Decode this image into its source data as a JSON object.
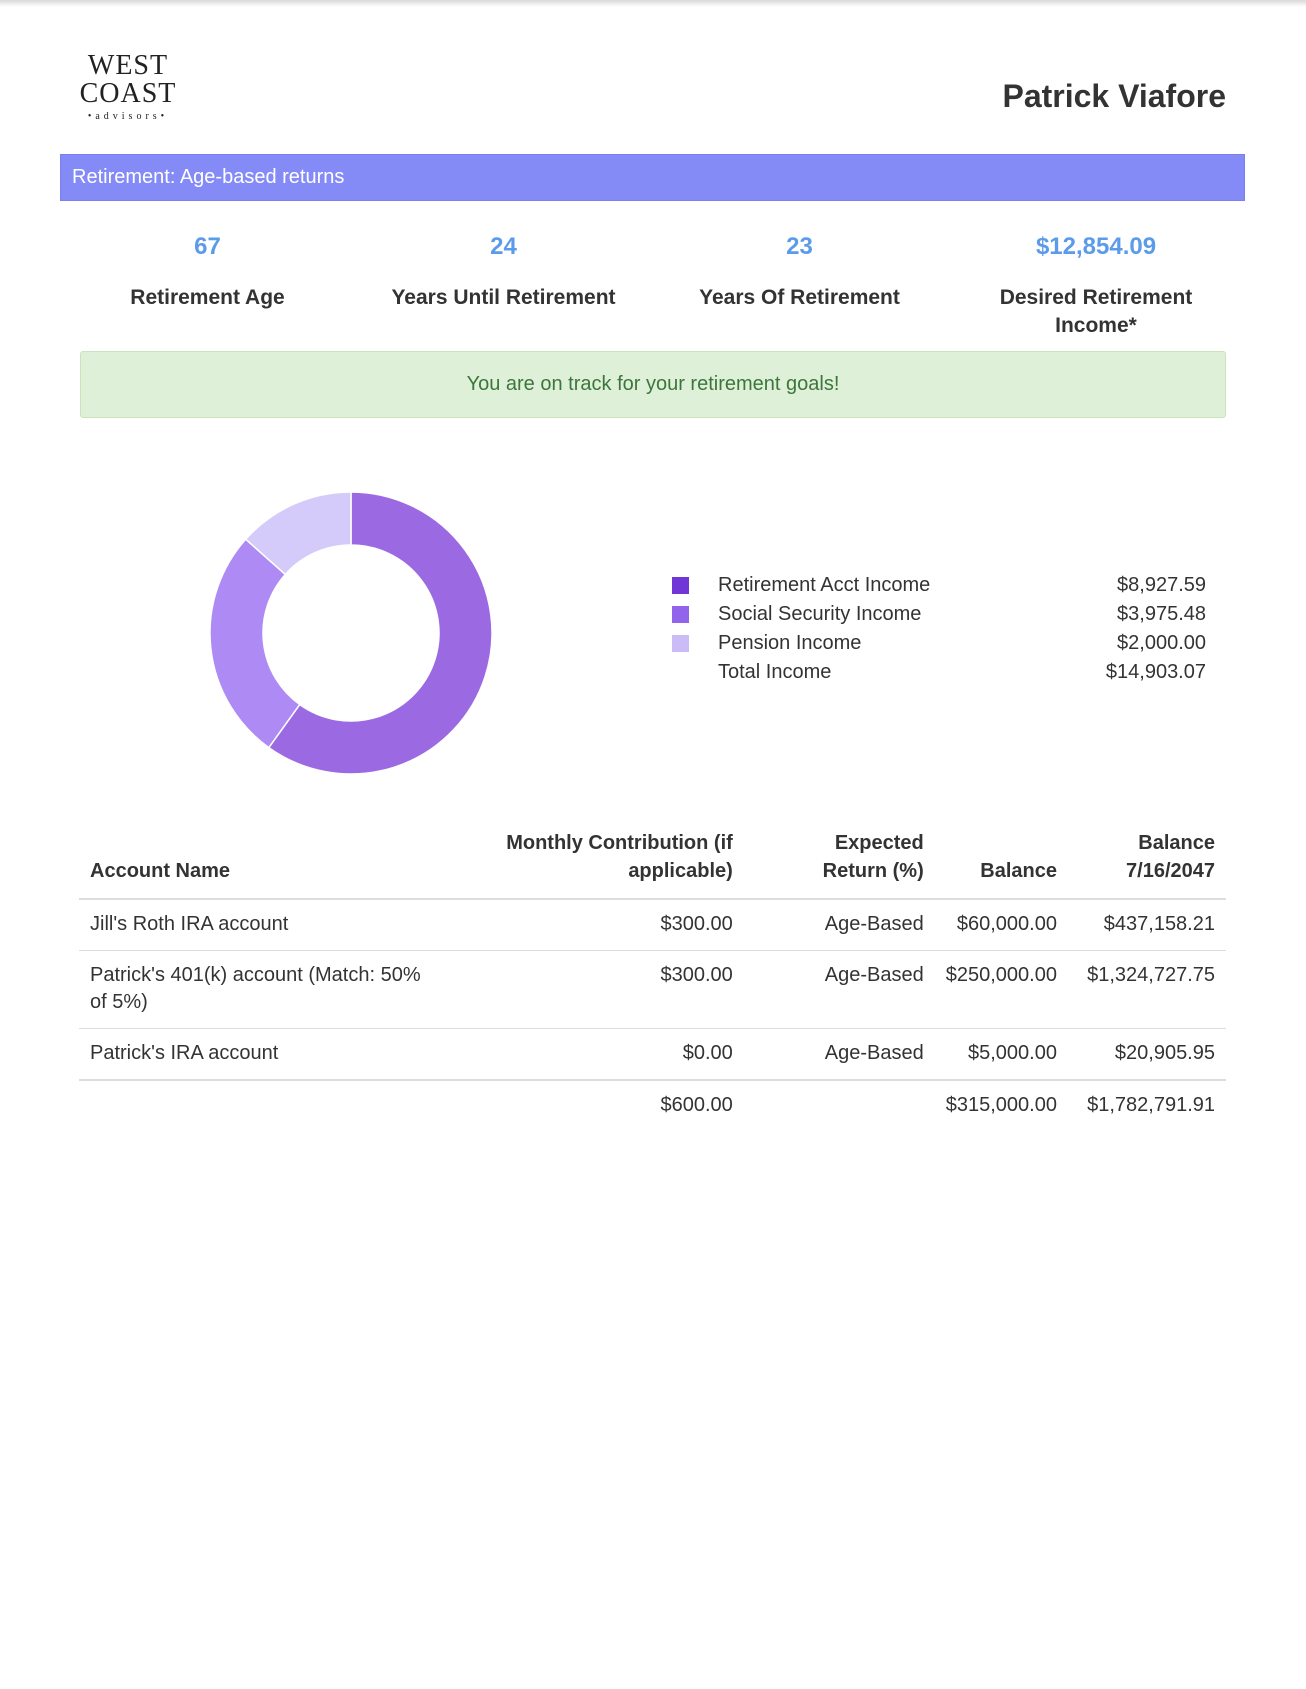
{
  "header": {
    "logo": {
      "line1": "WEST",
      "line2": "COAST",
      "line3": "•advisors•"
    },
    "client_name": "Patrick Viafore"
  },
  "section": {
    "title": "Retirement: Age-based returns",
    "color": "#848bf7"
  },
  "stats": [
    {
      "value": "67",
      "label": "Retirement Age"
    },
    {
      "value": "24",
      "label": "Years Until Retirement"
    },
    {
      "value": "23",
      "label": "Years Of Retirement"
    },
    {
      "value": "$12,854.09",
      "label": "Desired Retirement Income*"
    }
  ],
  "alert": {
    "message": "You are on track for your retirement goals!",
    "status": "success"
  },
  "chart_data": {
    "type": "pie",
    "donut": true,
    "categories": [
      "Retirement Acct Income",
      "Social Security Income",
      "Pension Income"
    ],
    "values": [
      8927.59,
      3975.48,
      2000.0
    ],
    "colors": [
      "#9b6ae3",
      "#ae8af4",
      "#d5cbfa"
    ]
  },
  "legend": {
    "items": [
      {
        "label": "Retirement Acct Income",
        "amount": "$8,927.59",
        "color": "#7136d6"
      },
      {
        "label": "Social Security Income",
        "amount": "$3,975.48",
        "color": "#9264ec"
      },
      {
        "label": "Pension Income",
        "amount": "$2,000.00",
        "color": "#cbbcf8"
      }
    ],
    "total": {
      "label": "Total Income",
      "amount": "$14,903.07"
    }
  },
  "accounts": {
    "headers": {
      "name": "Account Name",
      "contribution": "Monthly Contribution (if applicable)",
      "expected_return": "Expected Return (%)",
      "balance": "Balance",
      "future_balance": "Balance 7/16/2047"
    },
    "rows": [
      {
        "name": "Jill's Roth IRA account",
        "contribution": "$300.00",
        "expected_return": "Age-Based",
        "balance": "$60,000.00",
        "future_balance": "$437,158.21"
      },
      {
        "name": "Patrick's 401(k) account (Match: 50% of 5%)",
        "contribution": "$300.00",
        "expected_return": "Age-Based",
        "balance": "$250,000.00",
        "future_balance": "$1,324,727.75"
      },
      {
        "name": "Patrick's IRA account",
        "contribution": "$0.00",
        "expected_return": "Age-Based",
        "balance": "$5,000.00",
        "future_balance": "$20,905.95"
      }
    ],
    "totals": {
      "contribution": "$600.00",
      "balance": "$315,000.00",
      "future_balance": "$1,782,791.91"
    }
  }
}
